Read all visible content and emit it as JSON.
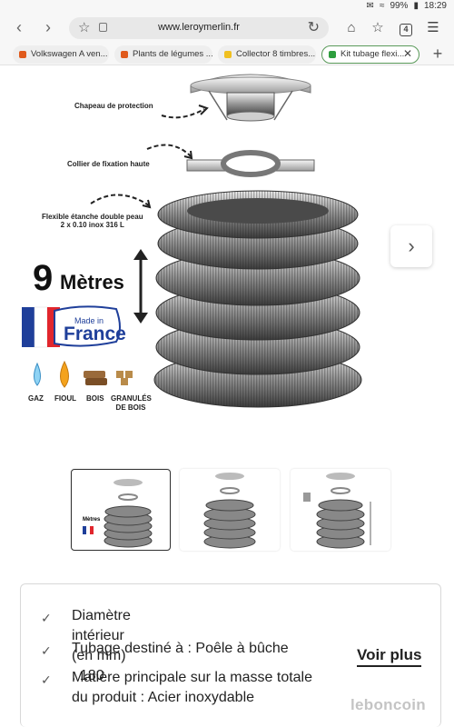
{
  "status_bar": {
    "battery": "99%",
    "time": "18:29"
  },
  "browser": {
    "url": "www.leroymerlin.fr",
    "tab_count": "4",
    "tabs": [
      {
        "label": "Volkswagen A ven...",
        "favicon_color": "#e05a1c"
      },
      {
        "label": "Plants de légumes ...",
        "favicon_color": "#e05a1c"
      },
      {
        "label": "Collector 8 timbres...",
        "favicon_color": "#f0c020"
      },
      {
        "label": "Kit tubage flexi...",
        "favicon_color": "#2e9e3e",
        "active": true
      }
    ]
  },
  "product_image": {
    "captions": {
      "chapeau": "Chapeau de protection",
      "collier": "Collier de fixation haute",
      "flexible_line1": "Flexible étanche double peau",
      "flexible_line2": "2 x 0.10 inox 316 L"
    },
    "length_number": "9",
    "length_unit": "Mètres",
    "badge_line1": "Made in",
    "badge_line2": "France",
    "fuels": [
      "GAZ",
      "FIOUL",
      "BOIS",
      "GRANULÉS DE BOIS"
    ],
    "colors": {
      "flag_blue": "#1f3f9a",
      "flag_red": "#e1262d",
      "steel": "#7a7a7a"
    }
  },
  "specs": [
    {
      "text": "Diamètre intérieur (en mm) : 180"
    },
    {
      "text": "Tubage destiné à : Poêle à bûche"
    },
    {
      "text_line1": "Matière principale sur la masse totale",
      "text_line2": "du produit : Acier inoxydable"
    }
  ],
  "see_more_label": "Voir plus",
  "watermark": "leboncoin"
}
